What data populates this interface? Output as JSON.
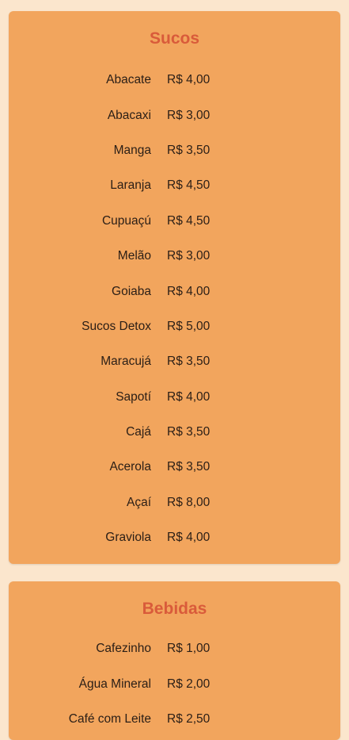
{
  "sections": [
    {
      "title": "Sucos",
      "items": [
        {
          "name": "Abacate",
          "price": "R$ 4,00"
        },
        {
          "name": "Abacaxi",
          "price": "R$ 3,00"
        },
        {
          "name": "Manga",
          "price": "R$ 3,50"
        },
        {
          "name": "Laranja",
          "price": "R$ 4,50"
        },
        {
          "name": "Cupuaçú",
          "price": "R$ 4,50"
        },
        {
          "name": "Melão",
          "price": "R$ 3,00"
        },
        {
          "name": "Goiaba",
          "price": "R$ 4,00"
        },
        {
          "name": "Sucos Detox",
          "price": "R$ 5,00"
        },
        {
          "name": "Maracujá",
          "price": "R$ 3,50"
        },
        {
          "name": "Sapotí",
          "price": "R$ 4,00"
        },
        {
          "name": "Cajá",
          "price": "R$ 3,50"
        },
        {
          "name": "Acerola",
          "price": "R$ 3,50"
        },
        {
          "name": "Açaí",
          "price": "R$ 8,00"
        },
        {
          "name": "Graviola",
          "price": "R$ 4,00"
        }
      ]
    },
    {
      "title": "Bebidas",
      "items": [
        {
          "name": "Cafezinho",
          "price": "R$ 1,00"
        },
        {
          "name": "Água Mineral",
          "price": "R$ 2,00"
        },
        {
          "name": "Café com Leite",
          "price": "R$ 2,50"
        }
      ]
    }
  ],
  "colors": {
    "page_background": "#fbe6cd",
    "card_background": "#f2a55d",
    "title": "#d95b3a",
    "text": "#2a1e16"
  }
}
